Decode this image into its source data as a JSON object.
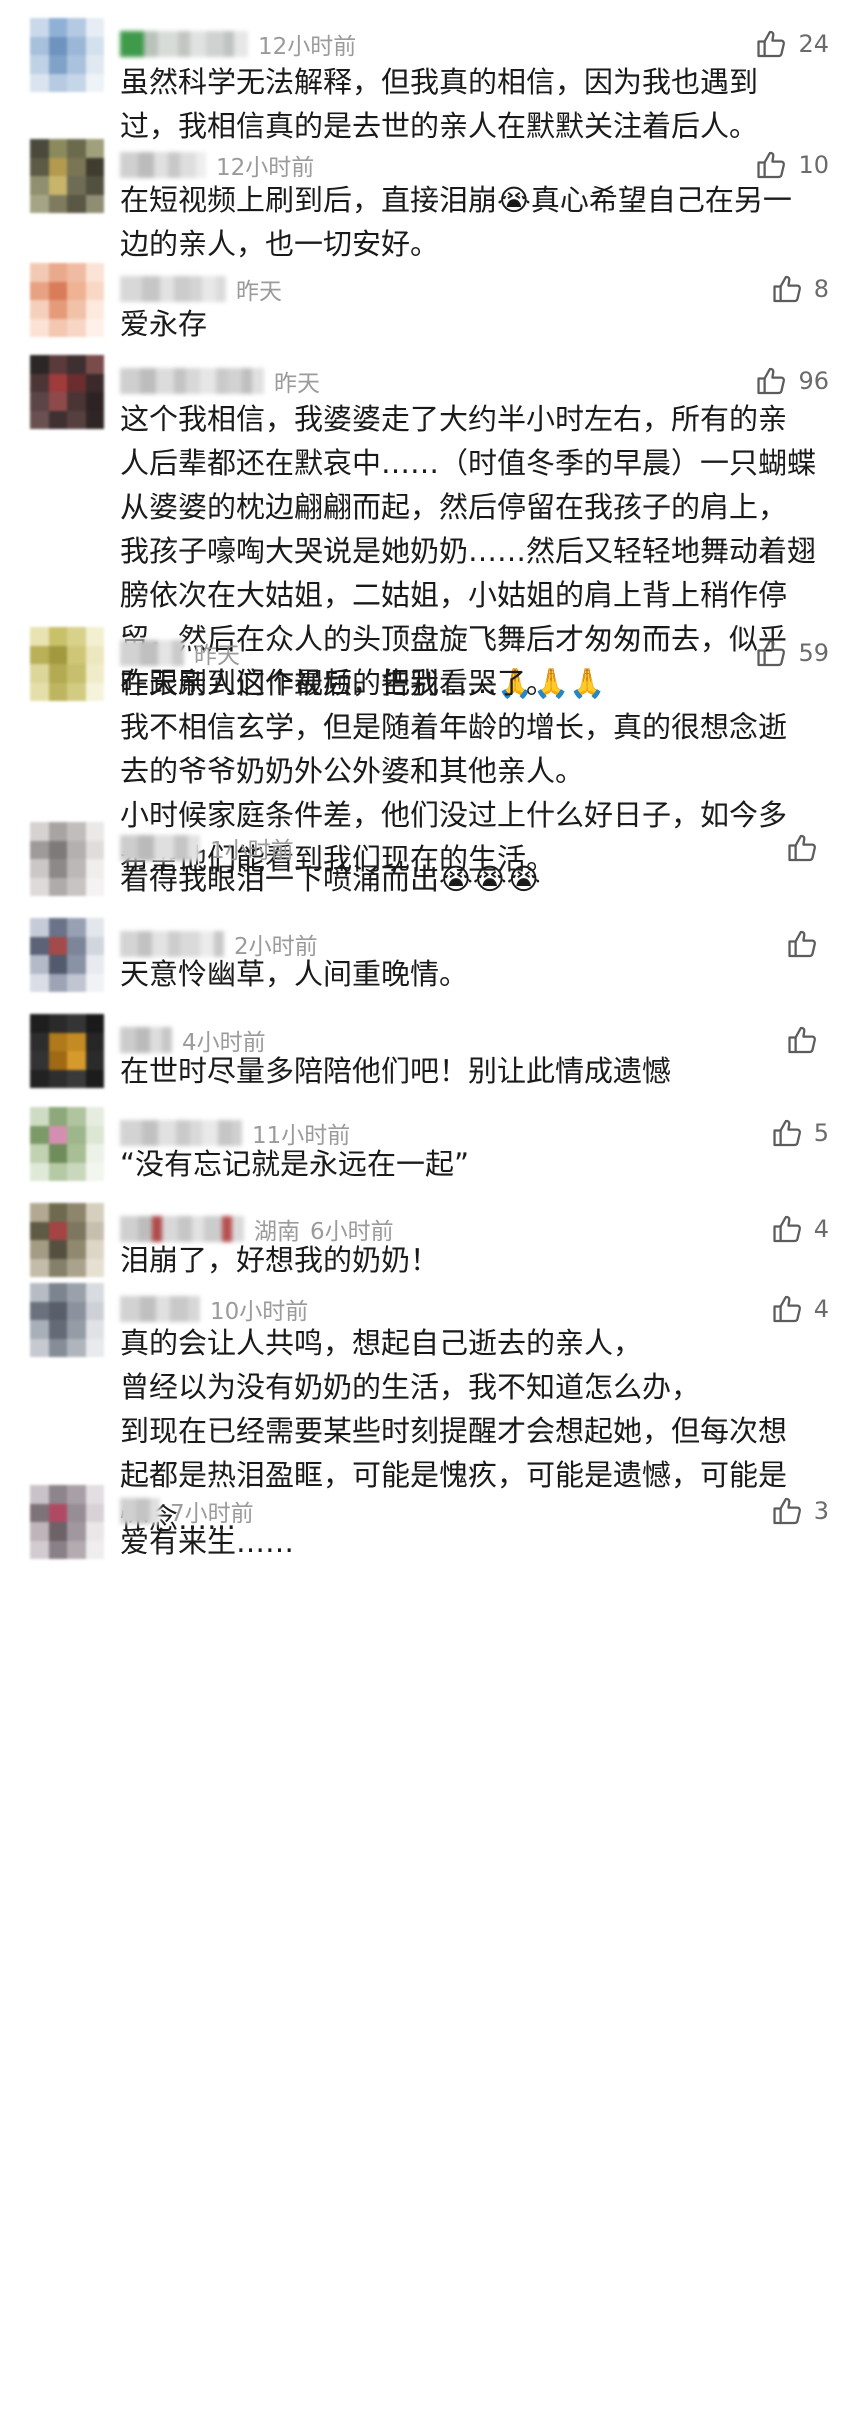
{
  "comments": [
    {
      "time": "12小时前",
      "location": "",
      "likes": "24",
      "lines": [
        "虽然科学无法解释，但我真的相信，因为我也遇到",
        "过，我相信真的是去世的亲人在默默关注着后人。"
      ],
      "avatar_colors": [
        "#c9d8ea",
        "#8fb1d6",
        "#b4c9e2",
        "#e6edf5",
        "#a7c0dc",
        "#6f93bf",
        "#9bb7d7",
        "#d3e0ee",
        "#bfd1e6",
        "#7fa2c8",
        "#aac2dd",
        "#e0e8f2",
        "#d9e4f0",
        "#b6cae1",
        "#c5d6e9",
        "#eef3f8"
      ],
      "name_colors": [
        "#3f9a4c",
        "#b9c3ba",
        "#d8dcd9",
        "#c2c6c3",
        "#e0e2e1",
        "#cfd2d0",
        "#bfc3c1",
        "#e6e7e6"
      ]
    },
    {
      "time": "12小时前",
      "location": "",
      "likes": "10",
      "lines": [
        "在短视频上刷到后，直接泪崩😭真心希望自己在另一",
        "边的亲人，也一切安好。"
      ],
      "avatar_colors": [
        "#4a4a3c",
        "#8c8a5d",
        "#6b6a4d",
        "#a0a07c",
        "#5d5a45",
        "#b49a4e",
        "#7a7554",
        "#3f3c30",
        "#90906e",
        "#c8b46b",
        "#6e6c54",
        "#52503f",
        "#a6a486",
        "#7e7b5e",
        "#5a5845",
        "#8f8d73"
      ],
      "name_colors": [
        "#d0d0d0",
        "#bcbcbc",
        "#e0e0e0",
        "#c8c8c8",
        "#dedede",
        "#eeeeee"
      ]
    },
    {
      "time": "昨天",
      "location": "",
      "likes": "8",
      "lines": [
        "爱永存"
      ],
      "avatar_colors": [
        "#f3c9b4",
        "#e9a98d",
        "#f0bba3",
        "#fbe3d6",
        "#e8a182",
        "#d97c5a",
        "#efb393",
        "#f8d7c5",
        "#f5cfbc",
        "#e59a7a",
        "#f1c1a8",
        "#fde9de",
        "#fbe2d4",
        "#f4c7b0",
        "#f7d6c5",
        "#fff1e9"
      ],
      "name_colors": [
        "#d8d8d8",
        "#c6c6c6",
        "#e2e2e2",
        "#cccccc",
        "#d4d4d4",
        "#e8e8e8",
        "#dcdcdc"
      ]
    },
    {
      "time": "昨天",
      "location": "",
      "likes": "96",
      "lines": [
        "这个我相信，我婆婆走了大约半小时左右，所有的亲",
        "人后辈都还在默哀中……（时值冬季的早晨）一只蝴蝶",
        "从婆婆的枕边翩翩而起，然后停留在我孩子的肩上，",
        "我孩子嚎啕大哭说是她奶奶……然后又轻轻地舞动着翅",
        "膀依次在大姑姐，二姑姐，小姑姐的肩上背上稍作停",
        "留，然后在众人的头顶盘旋飞舞后才匆匆而去，似乎",
        "在跟亲人们作最后的告别……🙏🙏🙏"
      ],
      "avatar_colors": [
        "#2c2626",
        "#5a3a3a",
        "#3e2f30",
        "#7a4b4b",
        "#4d3536",
        "#a03b3b",
        "#6b2d2e",
        "#3a2a2b",
        "#5c4546",
        "#8e4a4a",
        "#4a3434",
        "#2e2324",
        "#6a5051",
        "#3f3031",
        "#55403f",
        "#302526"
      ],
      "name_colors": [
        "#cfcfcf",
        "#bdbdbd",
        "#dcdcdc",
        "#c4c4c4",
        "#d8d8d8",
        "#e6e6e6",
        "#cacaca",
        "#d2d2d2",
        "#bfbfbf",
        "#e0e0e0"
      ]
    },
    {
      "time": "昨天",
      "location": "",
      "likes": "59",
      "lines": [
        "昨天刷到这个视频，把我看哭了。",
        "我不相信玄学，但是随着年龄的增长，真的很想念逝",
        "去的爷爷奶奶外公外婆和其他亲人。",
        "小时候家庭条件差，他们没过上什么好日子，如今多",
        "希望他们能看到我们现在的生活。"
      ],
      "avatar_colors": [
        "#e8e3b0",
        "#c9c06a",
        "#d7d18b",
        "#f3f0d2",
        "#b9b058",
        "#a2993f",
        "#cfc777",
        "#ece7bf",
        "#dcd69a",
        "#b3aa52",
        "#c7bf6d",
        "#f0ecc9",
        "#e4dfaa",
        "#bdb55f",
        "#d2cb82",
        "#f6f3dc"
      ],
      "name_colors": [
        "#d2d2d2",
        "#c0c0c0",
        "#e4e4e4",
        "#cbcbcb"
      ]
    },
    {
      "time": "1小时前",
      "location": "",
      "likes": "",
      "lines": [
        "看得我眼泪一下喷涌而出😭😭😭"
      ],
      "avatar_colors": [
        "#d6d2d2",
        "#a9a4a4",
        "#c2bdbd",
        "#ebe8e8",
        "#9f9a9a",
        "#7f7a7a",
        "#b5b0b0",
        "#e0dcdc",
        "#cbc7c7",
        "#8e8989",
        "#bdb8b8",
        "#f0eded",
        "#dedada",
        "#b0abab",
        "#c8c4c4",
        "#f4f2f2"
      ],
      "name_colors": [
        "#cdcdcd",
        "#bababa",
        "#dfdfdf",
        "#c5c5c5",
        "#e2e2e2"
      ]
    },
    {
      "time": "2小时前",
      "location": "",
      "likes": "",
      "lines": [
        "天意怜幽草，人间重晚情。"
      ],
      "avatar_colors": [
        "#c5cbd8",
        "#6a7389",
        "#98a0b3",
        "#e3e6ec",
        "#5c6378",
        "#a34a4a",
        "#7d8599",
        "#d1d5de",
        "#b4bac8",
        "#525a6e",
        "#8a92a6",
        "#e8eaef",
        "#dadde5",
        "#9da4b5",
        "#c0c5d1",
        "#f1f2f5"
      ],
      "name_colors": [
        "#d4d4d4",
        "#c2c2c2",
        "#e3e3e3",
        "#cdcdcd",
        "#dadada",
        "#ebebeb",
        "#c8c8c8"
      ]
    },
    {
      "time": "4小时前",
      "location": "",
      "likes": "",
      "lines": [
        "在世时尽量多陪陪他们吧！别让此情成遗憾"
      ],
      "avatar_colors": [
        "#1e1e1e",
        "#2a2a2a",
        "#353535",
        "#1a1a1a",
        "#2d2d2d",
        "#b07a1c",
        "#c48a24",
        "#262626",
        "#333333",
        "#a06a14",
        "#d69a2c",
        "#2b2b2b",
        "#222222",
        "#2e2e2e",
        "#3a3a3a",
        "#1c1c1c"
      ],
      "name_colors": [
        "#cccccc",
        "#bbbbbb",
        "#dddddd",
        "#c7c7c7"
      ]
    },
    {
      "time": "11小时前",
      "location": "",
      "likes": "5",
      "lines": [
        "“没有忘记就是永远在一起”"
      ],
      "avatar_colors": [
        "#cfdcc4",
        "#8da87a",
        "#b0c49f",
        "#e6ede0",
        "#7c9a67",
        "#d48fb0",
        "#9eb68b",
        "#dce6d3",
        "#c1d2b3",
        "#6f8d5a",
        "#a8bf95",
        "#edf2e8",
        "#e0e9d8",
        "#b5c9a5",
        "#c9d8bc",
        "#f3f6ef"
      ],
      "name_colors": [
        "#d3d3d3",
        "#c1c1c1",
        "#e1e1e1",
        "#cacaca",
        "#d9d9d9",
        "#e9e9e9",
        "#c6c6c6",
        "#d0d0d0"
      ]
    },
    {
      "time": "6小时前",
      "location": "湖南",
      "likes": "4",
      "lines": [
        "泪崩了，好想我的奶奶！"
      ],
      "avatar_colors": [
        "#b3a892",
        "#6f6a4f",
        "#8d866c",
        "#d6cfbe",
        "#5e5a44",
        "#a54444",
        "#7d7760",
        "#c7bfae",
        "#a39b84",
        "#545040",
        "#90896f",
        "#ddd6c6",
        "#c4bca9",
        "#85806a",
        "#aaa28c",
        "#e6e0d3"
      ],
      "name_colors": [
        "#d0d0d0",
        "#bdbdbd",
        "#b04a4a",
        "#d8d8d8",
        "#c6c6c6",
        "#e2e2e2",
        "#cccccc",
        "#b85050",
        "#dadada"
      ]
    },
    {
      "time": "10小时前",
      "location": "",
      "likes": "4",
      "lines": [
        "真的会让人共鸣，想起自己逝去的亲人，",
        "曾经以为没有奶奶的生活，我不知道怎么办，",
        "到现在已经需要某些时刻提醒才会想起她，但每次想",
        "起都是热泪盈眶，可能是愧疚，可能是遗憾，可能是",
        "怀念……"
      ],
      "avatar_colors": [
        "#b7bcc4",
        "#7c8490",
        "#9aa1ab",
        "#d8dbe0",
        "#6b727d",
        "#585f6a",
        "#8b929d",
        "#cdd0d6",
        "#a9afb8",
        "#646b76",
        "#959ca6",
        "#e0e2e6",
        "#c6cad0",
        "#868d98",
        "#b0b5bd",
        "#e8eaed"
      ],
      "name_colors": [
        "#d2d2d2",
        "#c0c0c0",
        "#e0e0e0",
        "#c9c9c9",
        "#d7d7d7"
      ]
    },
    {
      "time": "7小时前",
      "location": "",
      "likes": "3",
      "lines": [
        "爱有来生……"
      ],
      "avatar_colors": [
        "#c9c2c7",
        "#8e848b",
        "#a99fa6",
        "#e3dee1",
        "#7d7379",
        "#b04a64",
        "#978d94",
        "#d8d2d6",
        "#bdb5ba",
        "#6c6268",
        "#a1979e",
        "#ebe7e9",
        "#d2cbcf",
        "#8a8087",
        "#b3abb0",
        "#f0edef"
      ],
      "name_colors": [
        "#d0d0d0",
        "#c4c4c4",
        "#e0e0e0"
      ]
    }
  ]
}
